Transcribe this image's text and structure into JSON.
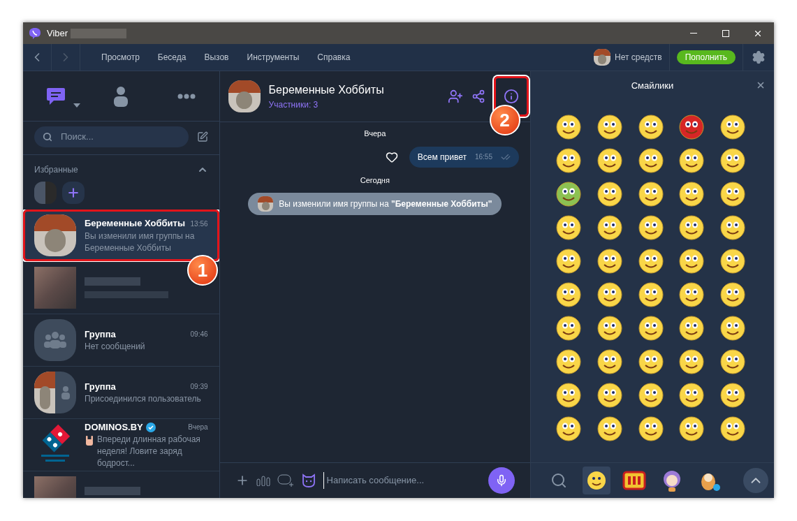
{
  "window": {
    "title": "Viber"
  },
  "menu": [
    "Просмотр",
    "Беседа",
    "Вызов",
    "Инструменты",
    "Справка"
  ],
  "balance": {
    "text": "Нет средств",
    "button": "Пополнить"
  },
  "sidebar_tabs": [
    {
      "kind": "chats",
      "selected": true
    },
    {
      "kind": "contacts",
      "selected": false
    },
    {
      "kind": "more",
      "selected": false
    }
  ],
  "search": {
    "placeholder": "Поиск..."
  },
  "favorites": {
    "label": "Избранные",
    "expanded": true
  },
  "chats": [
    {
      "kind": "photo",
      "name": "Беременные Хоббиты",
      "time": "13:56",
      "preview": "Вы изменили имя группы на Беременные Хоббиты",
      "selected": true
    },
    {
      "kind": "hidden",
      "selected": false
    },
    {
      "kind": "group",
      "name": "Группа",
      "time": "09:46",
      "preview": "Нет сообщений",
      "selected": false
    },
    {
      "kind": "split",
      "name": "Группа",
      "time": "09:39",
      "preview": "Присоединился пользователь",
      "selected": false
    },
    {
      "kind": "brand",
      "name": "DOMINOS.BY",
      "verified": true,
      "time": "Вчера",
      "preview": "Впереди длинная рабочая неделя! Ловите заряд бодрост...",
      "selected": false
    },
    {
      "kind": "hidden",
      "selected": false
    }
  ],
  "conversation": {
    "title": "Беременные Хоббиты",
    "subtitle": "Участники: 3",
    "messages": [
      {
        "kind": "day",
        "text": "Вчера"
      },
      {
        "kind": "outgoing",
        "text": "Всем привет",
        "time": "16:55"
      },
      {
        "kind": "day",
        "text": "Сегодня"
      },
      {
        "kind": "system",
        "text": "Вы изменили имя группы на **\"Беременные Хоббиты\"**"
      }
    ],
    "composer": {
      "placeholder": "Написать сообщение..."
    }
  },
  "stickers": {
    "title": "Смайлики",
    "tabs": [
      {
        "kind": "smiley",
        "selected": true
      },
      {
        "kind": "hi",
        "selected": false
      },
      {
        "kind": "girl",
        "selected": false
      },
      {
        "kind": "animal",
        "selected": false
      }
    ]
  },
  "annotations": [
    {
      "number": "1"
    },
    {
      "number": "2"
    }
  ]
}
